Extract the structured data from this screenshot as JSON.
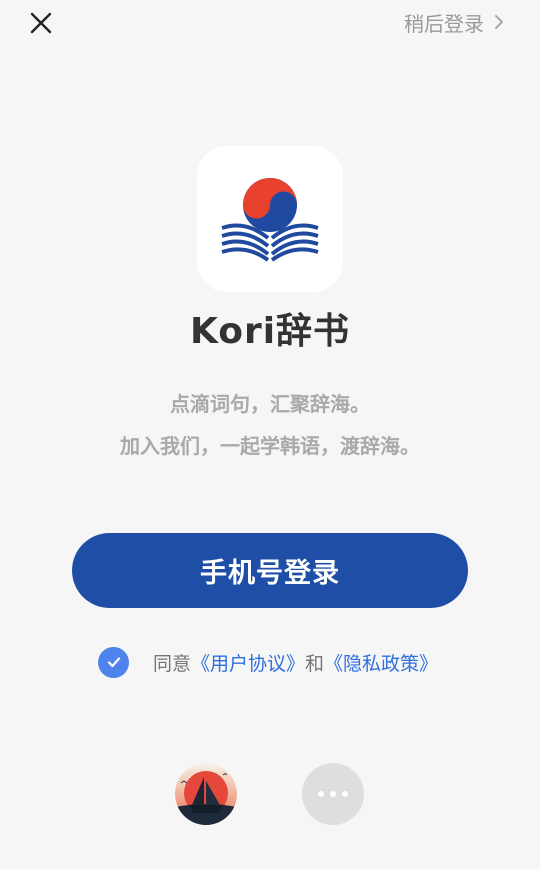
{
  "header": {
    "close_icon": "close-icon",
    "skip_label": "稍后登录",
    "skip_icon": "chevron-right-icon"
  },
  "app": {
    "name": "Kori辞书",
    "logo_icon": "korean-flag-book-logo",
    "tagline_1": "点滴词句，汇聚辞海。",
    "tagline_2": "加入我们，一起学韩语，渡辞海。"
  },
  "login": {
    "phone_button_label": "手机号登录"
  },
  "agreement": {
    "checked": true,
    "prefix": "同意",
    "user_agreement": "《用户协议》",
    "joiner": "和",
    "privacy_policy": "《隐私政策》"
  },
  "third_party": {
    "option_1_icon": "sailboat-sunset-app-icon",
    "option_2_icon": "more-icon"
  },
  "colors": {
    "background": "#f6f6f6",
    "primary": "#1e4ea6",
    "check": "#4e82ec",
    "link": "#2f6fe0",
    "flag_red": "#e8422f",
    "flag_blue": "#1f4aa0"
  }
}
